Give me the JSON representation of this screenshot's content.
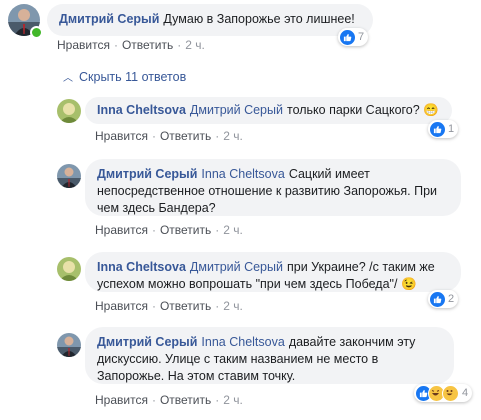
{
  "reaction_icons": [
    "like-icon",
    "haha-icon",
    "laugh-icon"
  ],
  "colors": {
    "link": "#385898",
    "bubble": "#f2f3f5",
    "online": "#42b72a",
    "like": "#1877f2"
  },
  "main": {
    "author": "Дмитрий Серый",
    "text": "Думаю в Запорожье это лишнее!",
    "like": "Нравится",
    "reply": "Ответить",
    "time": "2 ч.",
    "reactions": "7"
  },
  "toggle": "Скрыть 11 ответов",
  "replies": [
    {
      "author": "Inna Cheltsova",
      "mention": "Дмитрий Серый",
      "text": "только парки Сацкого?",
      "emoji": "😁",
      "like": "Нравится",
      "reply": "Ответить",
      "time": "2 ч.",
      "reactions": "1"
    },
    {
      "author": "Дмитрий Серый",
      "mention": "Inna Cheltsova",
      "text": "Сацкий имеет непосредственное отношение к развитию Запорожья. При чем здесь Бандера?",
      "like": "Нравится",
      "reply": "Ответить",
      "time": "2 ч."
    },
    {
      "author": "Inna Cheltsova",
      "mention": "Дмитрий Серый",
      "text": "при Украине? /с таким же успехом можно вопрошать \"при чем здесь Победа\"/",
      "emoji": "😉",
      "like": "Нравится",
      "reply": "Ответить",
      "time": "2 ч.",
      "reactions": "2"
    },
    {
      "author": "Дмитрий Серый",
      "mention": "Inna Cheltsova",
      "text": "давайте закончим эту дискуссию. Улице с таким названием не место в Запорожье. На этом ставим точку.",
      "like": "Нравится",
      "reply": "Ответить",
      "time": "2 ч.",
      "reactions": "4"
    }
  ]
}
